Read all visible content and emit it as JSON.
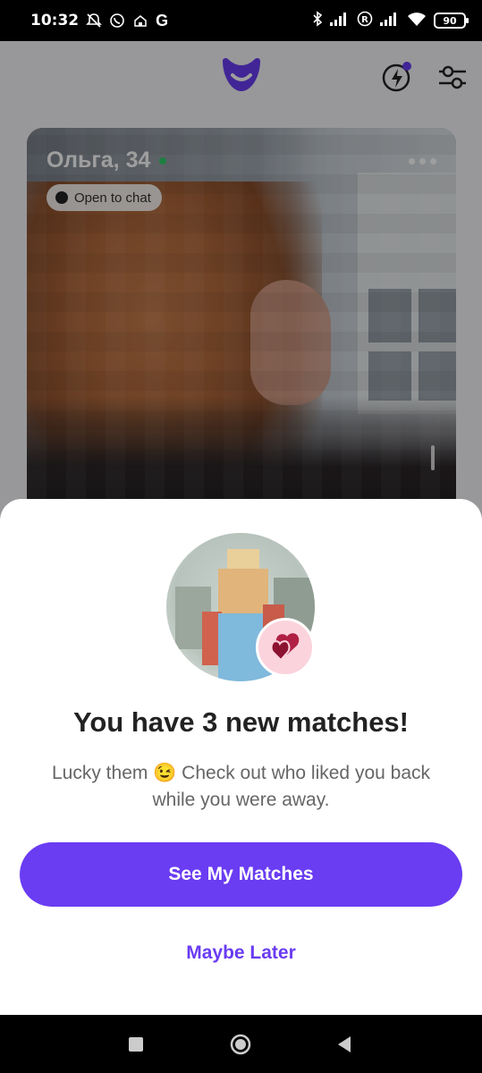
{
  "status_bar": {
    "time": "10:32",
    "g_label": "G",
    "battery": "90",
    "left_icons": [
      "mute-icon",
      "whatsapp-icon",
      "home-icon",
      "google-icon"
    ],
    "right_icons": [
      "bluetooth-icon",
      "signal-icon",
      "registered-icon",
      "signal-icon",
      "wifi-icon",
      "battery-icon"
    ]
  },
  "header": {
    "logo": "app-logo-icon",
    "icons": [
      "boost-icon",
      "filter-icon"
    ],
    "accent": "#6a3cf2"
  },
  "profile_card": {
    "name": "Ольга, 34",
    "status": "Open to chat"
  },
  "sheet": {
    "title": "You have 3 new matches!",
    "body": "Lucky them 😉 Check out who liked you back while you were away.",
    "primary_label": "See My Matches",
    "secondary_label": "Maybe Later",
    "badge_icon": "hearts-icon",
    "badge_color": "#9b1b3a"
  },
  "nav_bar": {
    "icons": [
      "recents-icon",
      "home-icon",
      "back-icon"
    ]
  }
}
